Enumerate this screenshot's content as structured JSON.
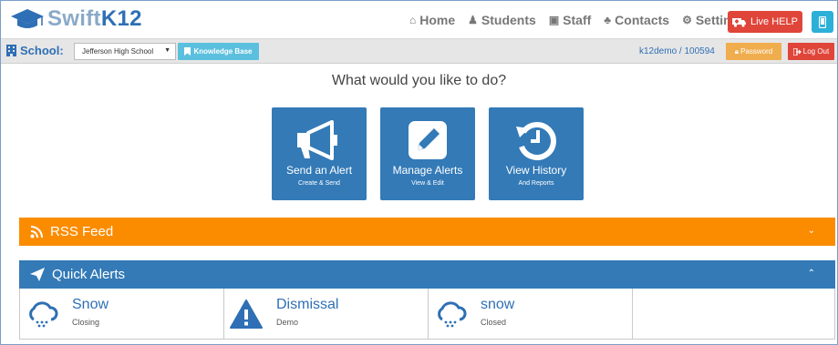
{
  "brand": {
    "part1": "Swift",
    "part2": "K12"
  },
  "nav": {
    "items": [
      {
        "label": "Home",
        "icon": "home-icon",
        "glyph": "⌂"
      },
      {
        "label": "Students",
        "icon": "student-icon",
        "glyph": "♟"
      },
      {
        "label": "Staff",
        "icon": "staff-icon",
        "glyph": "▣"
      },
      {
        "label": "Contacts",
        "icon": "contacts-icon",
        "glyph": "♣"
      },
      {
        "label": "Settings",
        "icon": "gear-icon",
        "glyph": "⚙"
      }
    ],
    "help_label": "Live HELP"
  },
  "subbar": {
    "school_label": "School:",
    "school_value": "Jefferson High School",
    "kb_label": "Knowledge Base",
    "user": "k12demo  /  100594",
    "password_label": "Password",
    "logout_label": "Log Out"
  },
  "main": {
    "question": "What would you like to do?",
    "tiles": [
      {
        "label": "Send an Alert",
        "sub": "Create & Send",
        "icon": "megaphone-icon"
      },
      {
        "label": "Manage Alerts",
        "sub": "View & Edit",
        "icon": "edit-icon"
      },
      {
        "label": "View History",
        "sub": "And Reports",
        "icon": "history-icon"
      }
    ]
  },
  "rss": {
    "title": "RSS Feed"
  },
  "quick_alerts": {
    "title": "Quick Alerts",
    "items": [
      {
        "name": "Snow",
        "sub": "Closing",
        "icon": "snow-cloud-icon"
      },
      {
        "name": "Dismissal",
        "sub": "Demo",
        "icon": "warning-icon"
      },
      {
        "name": "snow",
        "sub": "Closed",
        "icon": "snow-cloud-icon"
      }
    ]
  },
  "colors": {
    "primary": "#337ab7",
    "orange": "#fb8c00",
    "danger": "#e0453a",
    "info": "#5bc0de",
    "warning": "#f0ad4e"
  }
}
